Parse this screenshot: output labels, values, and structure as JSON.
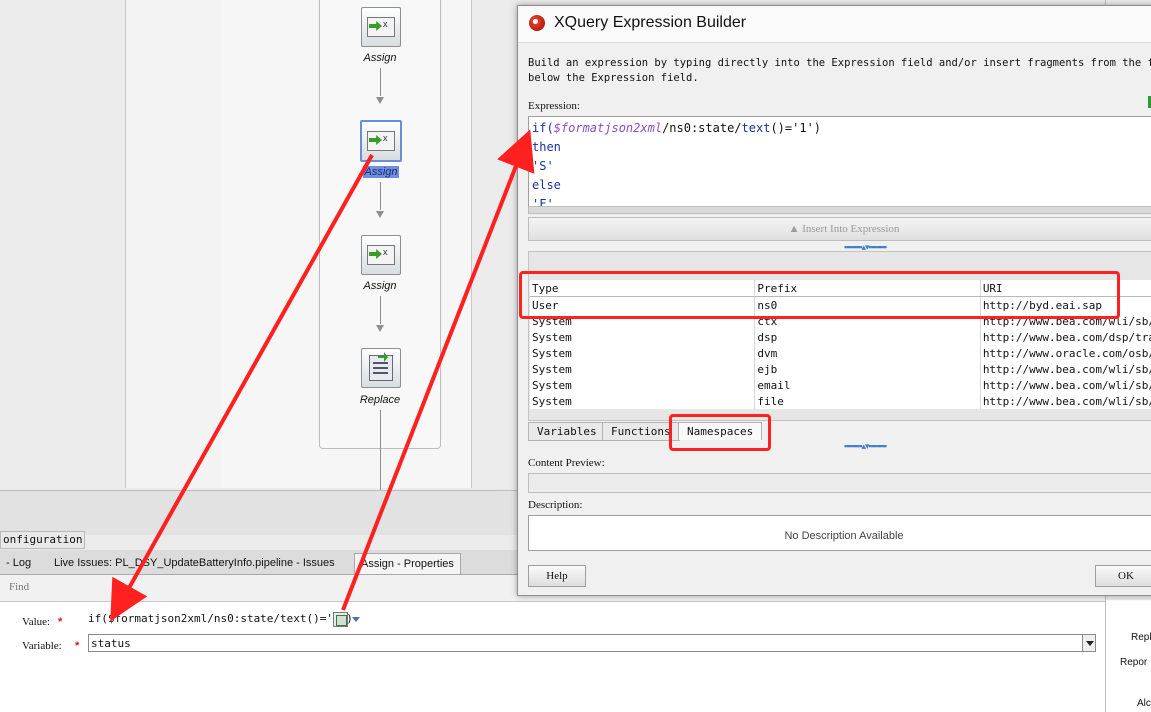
{
  "canvas": {
    "nodes": [
      {
        "label": "Assign",
        "kind": "assign"
      },
      {
        "label": "Assign",
        "kind": "assign",
        "selected": true
      },
      {
        "label": "Assign",
        "kind": "assign"
      },
      {
        "label": "Replace",
        "kind": "replace"
      }
    ]
  },
  "bottom_panel": {
    "config_tab": "onfiguration",
    "tabs": [
      {
        "label": "- Log"
      },
      {
        "label": "Live Issues: PL_DSY_UpdateBatteryInfo.pipeline - Issues"
      },
      {
        "label": "Assign - Properties",
        "active": true
      }
    ],
    "find_label": "Find",
    "value_label": "Value:",
    "value_text": "if($formatjson2xml/ns0:state/text()='1')",
    "variable_label": "Variable:",
    "variable_value": "status",
    "required_mark": "*"
  },
  "right_edge": {
    "texts": [
      "Repl",
      "Repor",
      "Alc"
    ]
  },
  "dialog": {
    "title": "XQuery Expression Builder",
    "instructions": "Build an expression by typing directly into the Expression field and/or insert fragments from the fragme\nbelow the Expression field.",
    "expression_label": "Expression:",
    "expression_lines": {
      "l1_kw": "if(",
      "l1_var": "$formatjson2xml",
      "l1_path": "/ns0:state/",
      "l1_fn": "text",
      "l1_rest": "()='1')",
      "l2": "then",
      "l3": "'S'",
      "l4": "else",
      "l5": "'F'"
    },
    "insert_button": "Insert Into Expression",
    "namespace_table": {
      "headers": [
        "Type",
        "Prefix",
        "URI"
      ],
      "rows": [
        [
          "User",
          "ns0",
          "http://byd.eai.sap"
        ],
        [
          "System",
          "ctx",
          "http://www.bea.com/wli/sb/"
        ],
        [
          "System",
          "dsp",
          "http://www.bea.com/dsp/tra"
        ],
        [
          "System",
          "dvm",
          "http://www.oracle.com/osb/"
        ],
        [
          "System",
          "ejb",
          "http://www.bea.com/wli/sb/"
        ],
        [
          "System",
          "email",
          "http://www.bea.com/wli/sb/"
        ],
        [
          "System",
          "file",
          "http://www.bea.com/wli/sb/"
        ]
      ]
    },
    "tabs": [
      {
        "label": "Variables"
      },
      {
        "label": "Functions"
      },
      {
        "label": "Namespaces",
        "active": true
      }
    ],
    "content_preview_label": "Content Preview:",
    "description_label": "Description:",
    "description_text": "No Description Available",
    "help_button": "Help",
    "ok_button": "OK"
  },
  "colors": {
    "highlight": "#ff2020",
    "keyword": "#1f2ea0",
    "variable": "#8c4cc7",
    "selection": "#6f8ee0"
  }
}
